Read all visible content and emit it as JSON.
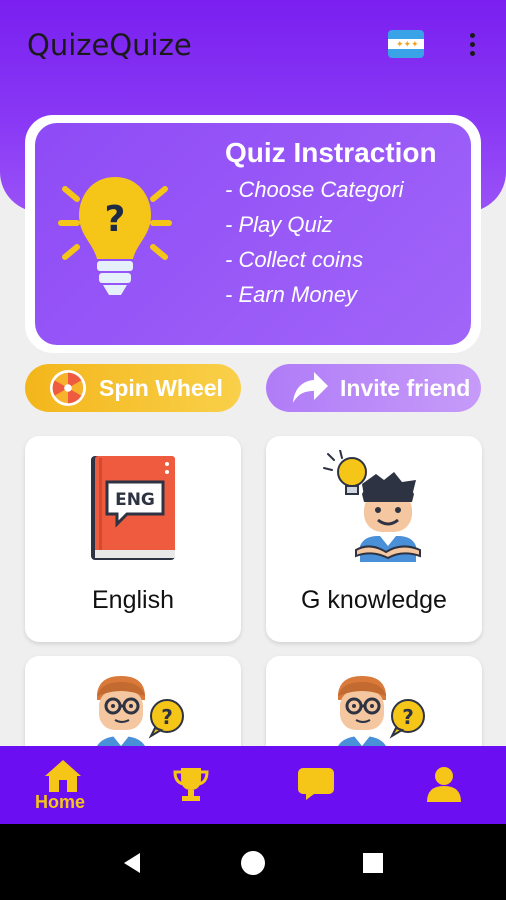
{
  "app": {
    "title": "QuizeQuize"
  },
  "header": {
    "flag_icon": "india-flag-icon",
    "menu_icon": "kebab-menu-icon"
  },
  "info_card": {
    "title": "Quiz Instraction",
    "lines": [
      "- Choose Categori",
      "- Play Quiz",
      "- Collect coins",
      "- Earn Money"
    ]
  },
  "actions": {
    "spin_label": "Spin Wheel",
    "invite_label": "Invite friend"
  },
  "categories": [
    {
      "label": "English",
      "icon": "english-book-icon",
      "book_text": "ENG"
    },
    {
      "label": "G knowledge",
      "icon": "idea-boy-icon"
    },
    {
      "label": "",
      "icon": "question-boy-icon"
    },
    {
      "label": "",
      "icon": "question-boy-icon"
    }
  ],
  "bottom_nav": {
    "home_label": "Home",
    "items": [
      "home-icon",
      "trophy-icon",
      "chat-icon",
      "profile-icon"
    ]
  },
  "colors": {
    "primary": "#6b0ef2",
    "accent": "#f5c518",
    "card_purple": "#9a5cf7"
  }
}
